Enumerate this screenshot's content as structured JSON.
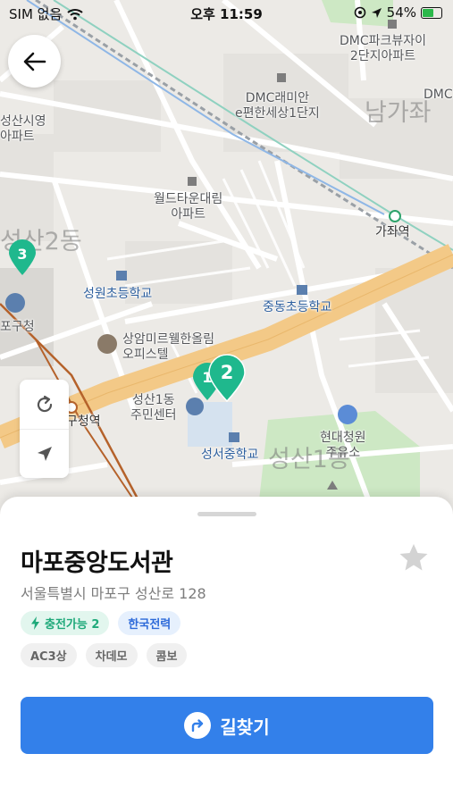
{
  "status_bar": {
    "carrier": "SIM 없음",
    "time": "오후 11:59",
    "battery": "54%"
  },
  "map": {
    "labels": {
      "dmc_parkview": "DMC파크뷰자이\n2단지아파트",
      "dmc_raemian": "DMC래미안\ne편한세상1단지",
      "dmc_edge": "DMC",
      "namgajwa": "남가좌",
      "seongsan_apt": "성산시영\n아파트",
      "worldtown": "월드타운대림\n아파트",
      "gajwa_station": "가좌역",
      "seongsan2": "성산2동",
      "seongwon_school": "성원초등학교",
      "jungdong_school": "중동초등학교",
      "mapo_office": "포구청",
      "sangam_officetel": "상암미르웰한올림\n오피스텔",
      "seongsan1_center": "성산1동\n주민센터",
      "guchung_station": "구청역",
      "hyundai_station": "현대청원\n주유소",
      "seongseo_school": "성서중학교",
      "seongsan1": "성산1동"
    },
    "markers": {
      "cluster_left": "3",
      "cluster_main": "2",
      "behind": "1"
    }
  },
  "sheet": {
    "title": "마포중앙도서관",
    "address": "서울특별시 마포구 성산로 128",
    "tags": {
      "charging": "충전가능 2",
      "operator": "한국전력",
      "types": [
        "AC3상",
        "차데모",
        "콤보"
      ]
    },
    "route_button": "길찾기"
  },
  "icons": {
    "back": "arrow-left-icon",
    "refresh": "refresh-icon",
    "locate": "location-arrow-icon",
    "favorite": "star-icon",
    "bolt": "lightning-icon",
    "route": "turn-right-icon"
  },
  "colors": {
    "accent": "#3380ea",
    "marker": "#1fb88d",
    "road_major": "#f3c987",
    "park": "#cde8c4"
  }
}
